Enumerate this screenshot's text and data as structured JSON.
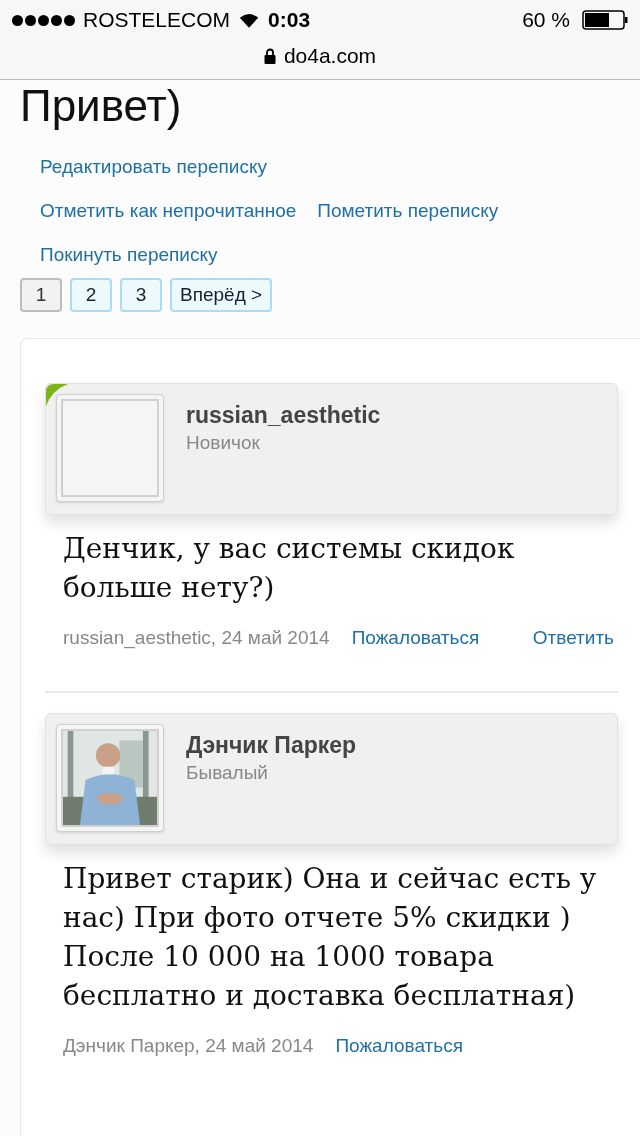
{
  "status_bar": {
    "carrier": "ROSTELECOM",
    "time": "0:03",
    "battery": "60 %"
  },
  "address_bar": {
    "url": "do4a.com"
  },
  "title": "Привет)",
  "actions": [
    {
      "label": "Редактировать переписку"
    },
    {
      "label": "Отметить как непрочитанное"
    },
    {
      "label": "Пометить переписку"
    },
    {
      "label": "Покинуть переписку"
    }
  ],
  "pagination": [
    {
      "label": "1",
      "selected": true
    },
    {
      "label": "2",
      "selected": false
    },
    {
      "label": "3",
      "selected": false
    },
    {
      "label": "Вперёд >",
      "selected": false
    }
  ],
  "messages": [
    {
      "author": "russian_aesthetic",
      "rank": "Новичок",
      "avatar": {
        "kind": "empty"
      },
      "is_new": true,
      "text": "Денчик, у вас системы скидок больше нету?)",
      "byline": "russian_aesthetic, 24 май 2014",
      "links": [
        "Пожаловаться",
        "Ответить"
      ]
    },
    {
      "author": "Дэнчик Паркер",
      "rank": "Бывалый",
      "avatar": {
        "kind": "picture"
      },
      "is_new": false,
      "text": "Привет старик) Она и сейчас есть у нас) При фото отчете 5% скидки ) После 10 000 на 1000 товара бесплатно и доставка бесплатная)",
      "byline": "Дэнчик Паркер, 24 май 2014",
      "links": [
        "Пожаловаться"
      ]
    }
  ]
}
